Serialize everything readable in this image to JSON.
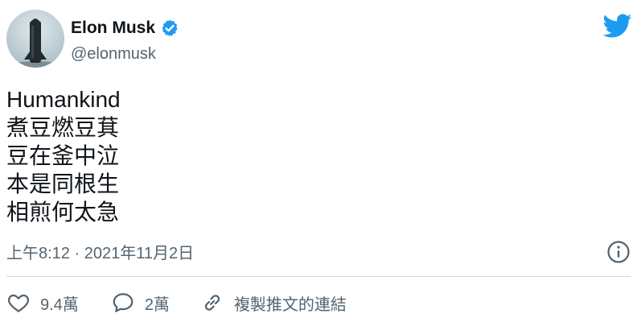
{
  "colors": {
    "brand": "#1d9bf0",
    "text": "#0f1419",
    "muted": "#536471",
    "divider": "#cfd9de"
  },
  "author": {
    "display_name": "Elon Musk",
    "handle": "@elonmusk",
    "verified": true,
    "avatar_icon": "starship-avatar"
  },
  "tweet": {
    "lines": [
      "Humankind",
      "煮豆燃豆萁",
      "豆在釜中泣",
      "本是同根生",
      "相煎何太急"
    ],
    "timestamp": "上午8:12 · 2021年11月2日"
  },
  "actions": {
    "like_count": "9.4萬",
    "reply_count": "2萬",
    "copy_link_label": "複製推文的連結"
  },
  "icons": {
    "brand": "twitter-bird-icon",
    "info": "info-icon",
    "like": "heart-icon",
    "reply": "speech-bubble-icon",
    "link": "link-icon",
    "verified": "verified-badge-icon"
  }
}
